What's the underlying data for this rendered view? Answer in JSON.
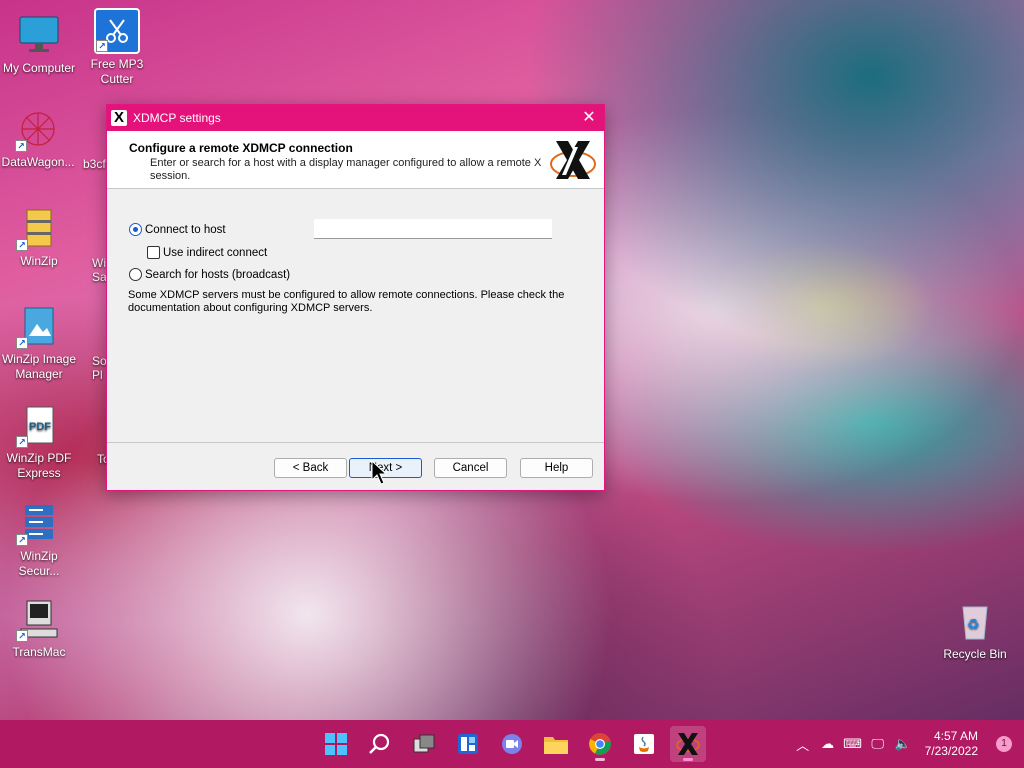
{
  "desktop": {
    "icons": [
      {
        "label": "My Computer"
      },
      {
        "label": "Free MP3 Cutter"
      },
      {
        "label": "DataWagon..."
      },
      {
        "label": "b3cf"
      },
      {
        "label": "WinZip"
      },
      {
        "label": "Wi Sa"
      },
      {
        "label": "WinZip Image Manager"
      },
      {
        "label": "So Pl"
      },
      {
        "label": "WinZip PDF Express"
      },
      {
        "label": "To"
      },
      {
        "label": "WinZip Secur..."
      },
      {
        "label": "TransMac"
      },
      {
        "label": "Recycle Bin"
      }
    ]
  },
  "dialog": {
    "title": "XDMCP settings",
    "header_title": "Configure a remote XDMCP connection",
    "header_subtitle": "Enter or search for a host with a display manager configured to allow a remote X session.",
    "option_connect": "Connect to host",
    "option_indirect": "Use indirect connect",
    "option_search": "Search for hosts (broadcast)",
    "host_value": "",
    "note": "Some XDMCP servers must be configured to allow remote connections. Please check the documentation about configuring XDMCP servers.",
    "buttons": {
      "back": "< Back",
      "next": "Next >",
      "cancel": "Cancel",
      "help": "Help"
    }
  },
  "taskbar": {
    "time": "4:57 AM",
    "date": "7/23/2022",
    "notification_count": "1",
    "apps": [
      "start-icon",
      "search-icon",
      "task-view-icon",
      "widgets-icon",
      "teams-chat-icon",
      "file-explorer-icon",
      "chrome-icon",
      "java-icon",
      "xlaunch-icon"
    ]
  },
  "colors": {
    "accent": "#e4137c",
    "taskbar": "#b11962"
  }
}
